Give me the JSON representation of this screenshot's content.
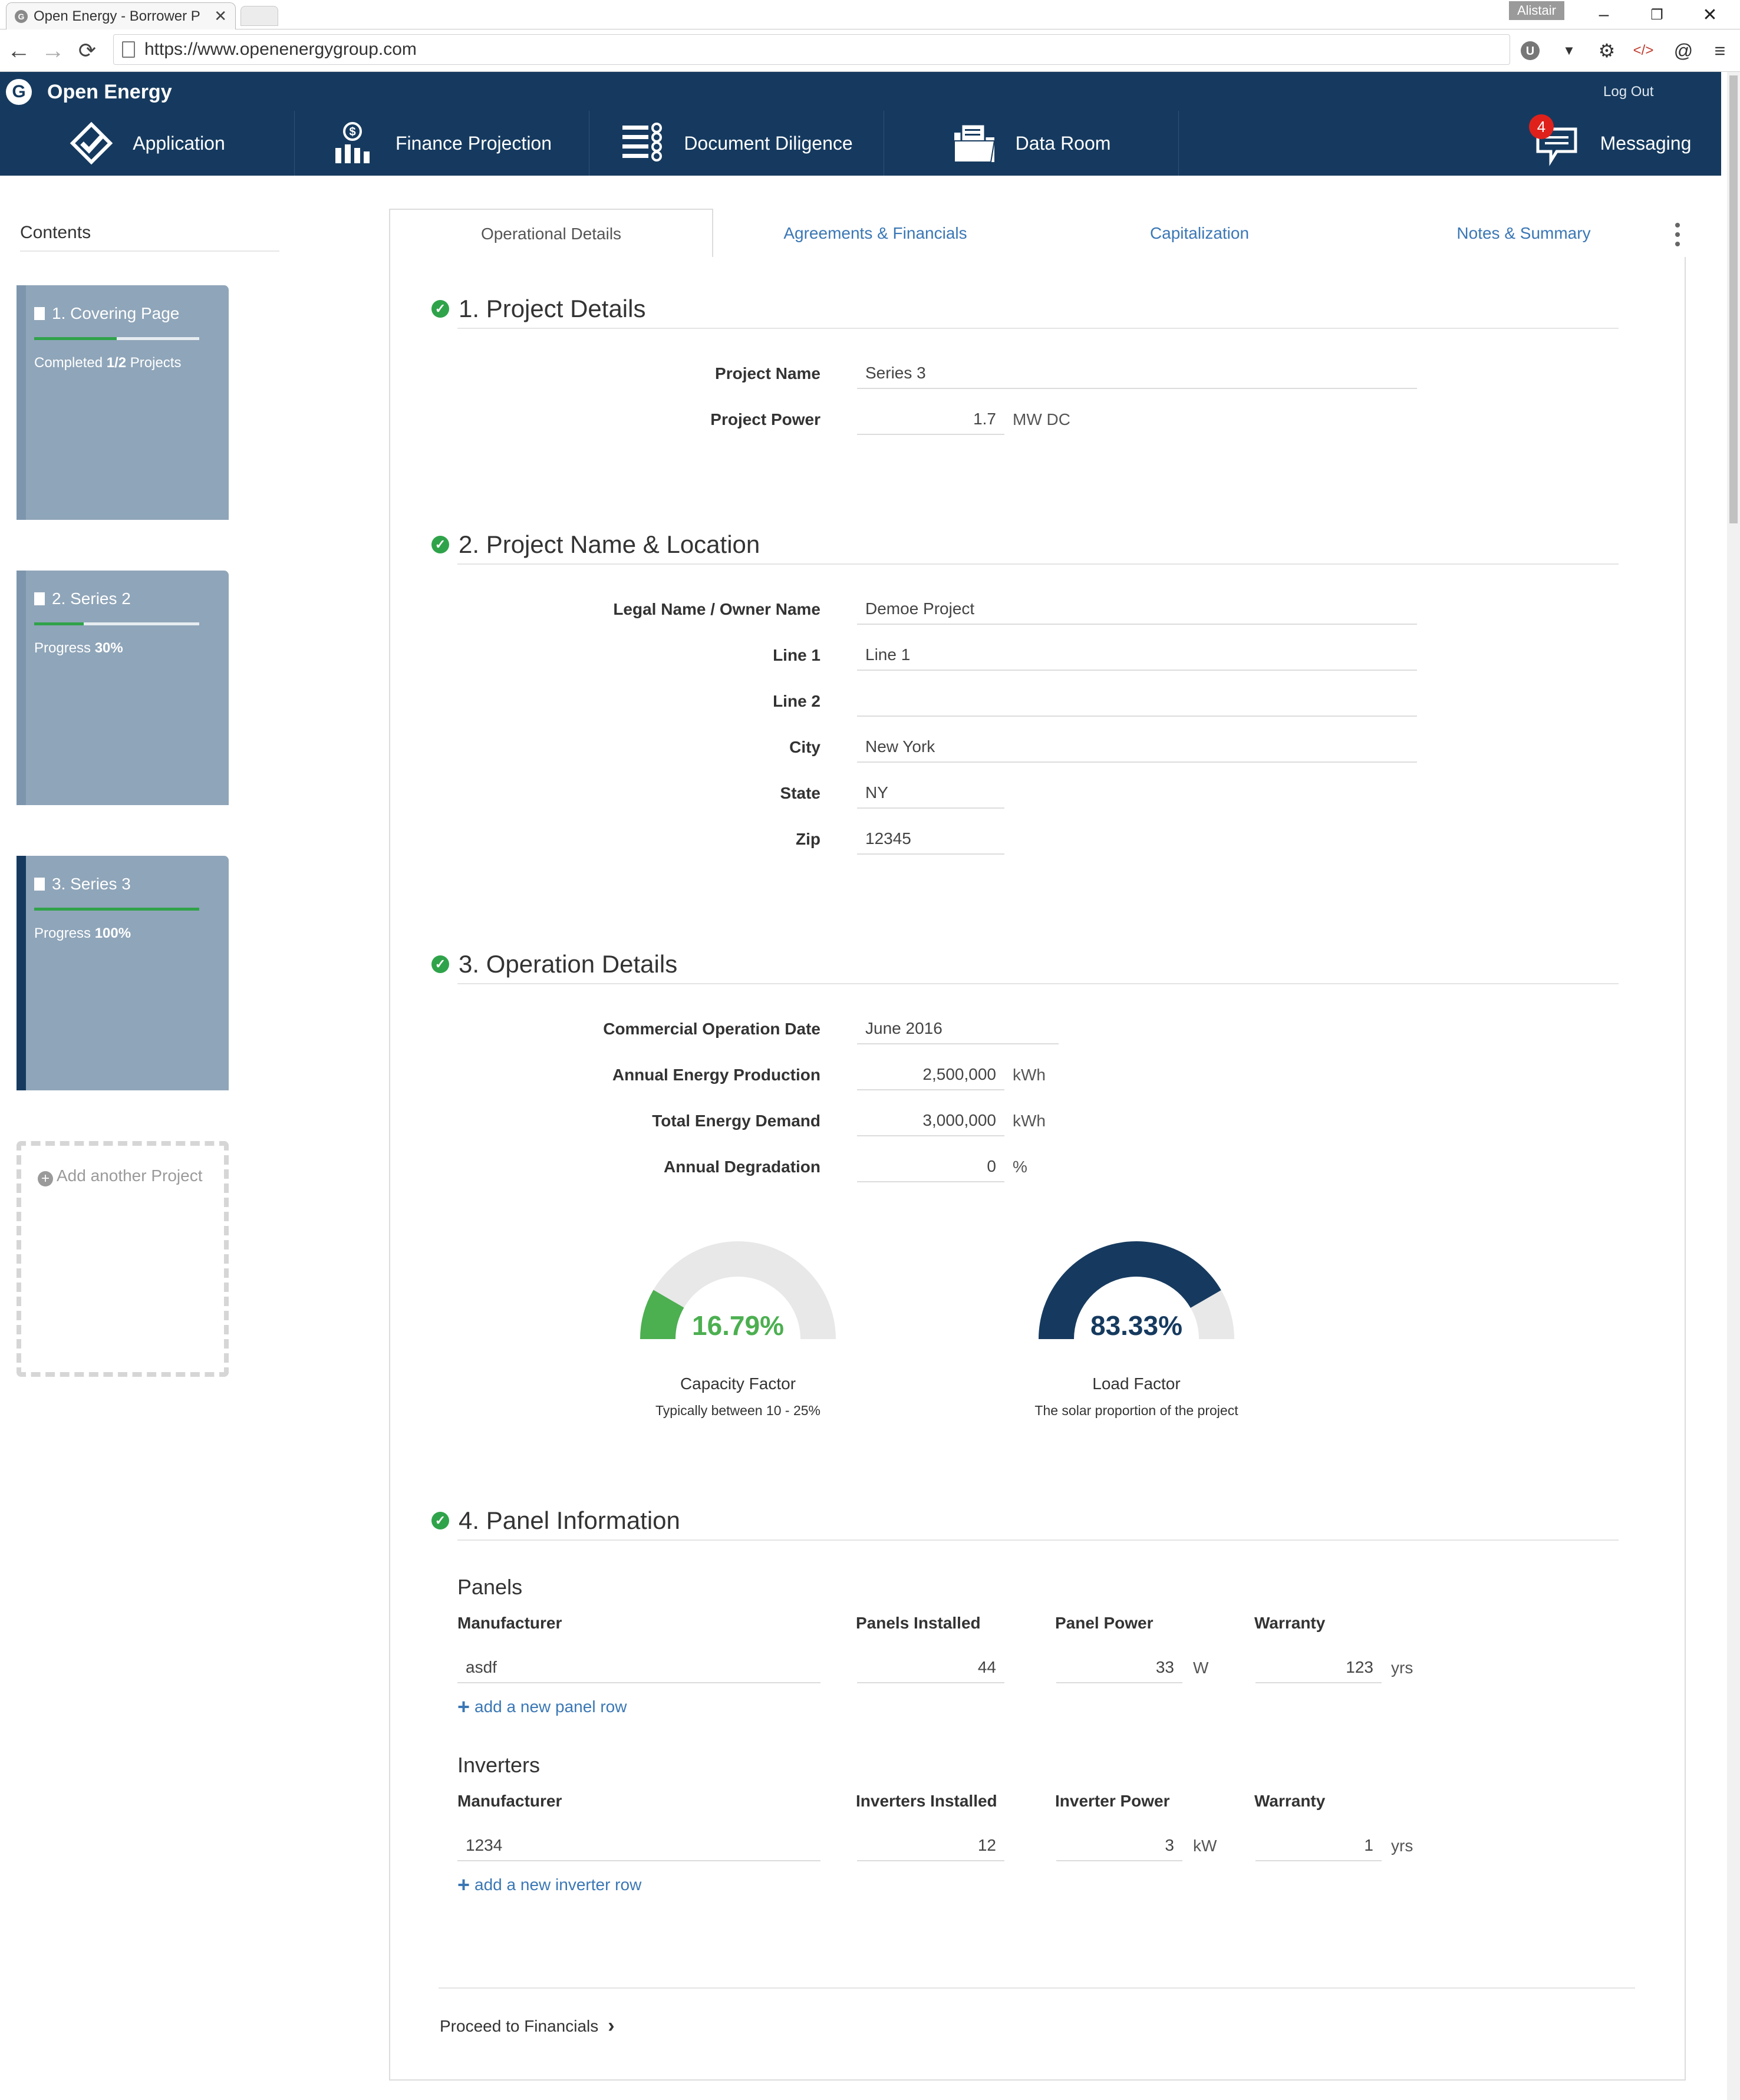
{
  "browser": {
    "tab_title": "Open Energy - Borrower P",
    "tab_close": "✕",
    "user_badge": "Alistair",
    "url": "https://www.openenergygroup.com",
    "minimize": "–",
    "restore": "❐",
    "close": "✕"
  },
  "app": {
    "brand": "Open Energy",
    "logout": "Log Out",
    "nav": [
      {
        "label": "Application",
        "icon": "check-diamond-icon"
      },
      {
        "label": "Finance Projection",
        "icon": "bar-chart-dollar-icon"
      },
      {
        "label": "Document Diligence",
        "icon": "list-checks-icon"
      },
      {
        "label": "Data Room",
        "icon": "folder-icon"
      }
    ],
    "messaging": {
      "label": "Messaging",
      "badge": "4",
      "icon": "chat-icon"
    }
  },
  "sidebar": {
    "title": "Contents",
    "projects": [
      {
        "title": "1. Covering Page",
        "status_prefix": "Completed ",
        "status_value": "1/2",
        "status_suffix": " Projects",
        "progress": 0.5
      },
      {
        "title": "2. Series 2",
        "status_prefix": "Progress ",
        "status_value": "30%",
        "status_suffix": "",
        "progress": 0.3
      },
      {
        "title": "3. Series 3",
        "status_prefix": "Progress ",
        "status_value": "100%",
        "status_suffix": "",
        "progress": 1.0
      }
    ],
    "add_project": "Add another Project"
  },
  "tabs": [
    "Operational Details",
    "Agreements & Financials",
    "Capitalization",
    "Notes & Summary"
  ],
  "sections": {
    "project_details": {
      "title": "1. Project Details",
      "project_name_label": "Project Name",
      "project_name": "Series 3",
      "project_power_label": "Project Power",
      "project_power": "1.7",
      "project_power_unit": "MW DC"
    },
    "location": {
      "title": "2. Project Name & Location",
      "legal_name_label": "Legal Name / Owner Name",
      "legal_name": "Demoe Project",
      "line1_label": "Line 1",
      "line1": "Line 1",
      "line2_label": "Line 2",
      "line2": "",
      "city_label": "City",
      "city": "New York",
      "state_label": "State",
      "state": "NY",
      "zip_label": "Zip",
      "zip": "12345"
    },
    "operation": {
      "title": "3. Operation Details",
      "cod_label": "Commercial Operation Date",
      "cod": "June 2016",
      "aep_label": "Annual Energy Production",
      "aep": "2,500,000",
      "aep_unit": "kWh",
      "ted_label": "Total Energy Demand",
      "ted": "3,000,000",
      "ted_unit": "kWh",
      "deg_label": "Annual Degradation",
      "deg": "0",
      "deg_unit": "%",
      "capacity_factor": {
        "value_text": "16.79%",
        "fraction": 0.1679,
        "title": "Capacity Factor",
        "sub": "Typically between 10 - 25%",
        "color": "#4caf50"
      },
      "load_factor": {
        "value_text": "83.33%",
        "fraction": 0.8333,
        "title": "Load Factor",
        "sub": "The solar proportion of the project",
        "color": "#163a5f"
      }
    },
    "panel_info": {
      "title": "4. Panel Information",
      "panels": {
        "title": "Panels",
        "headers": [
          "Manufacturer",
          "Panels Installed",
          "Panel Power",
          "Warranty"
        ],
        "row": {
          "manufacturer": "asdf",
          "installed": "44",
          "power": "33",
          "power_unit": "W",
          "warranty": "123",
          "warranty_unit": "yrs"
        },
        "add_link": "add a new panel row"
      },
      "inverters": {
        "title": "Inverters",
        "headers": [
          "Manufacturer",
          "Inverters Installed",
          "Inverter Power",
          "Warranty"
        ],
        "row": {
          "manufacturer": "1234",
          "installed": "12",
          "power": "3",
          "power_unit": "kW",
          "warranty": "1",
          "warranty_unit": "yrs"
        },
        "add_link": "add a new inverter row"
      }
    }
  },
  "footer": {
    "proceed": "Proceed to Financials"
  },
  "colors": {
    "nav_bg": "#163a5f",
    "link": "#3a77b5",
    "success": "#2fa34a",
    "card": "#8fa5b9"
  }
}
